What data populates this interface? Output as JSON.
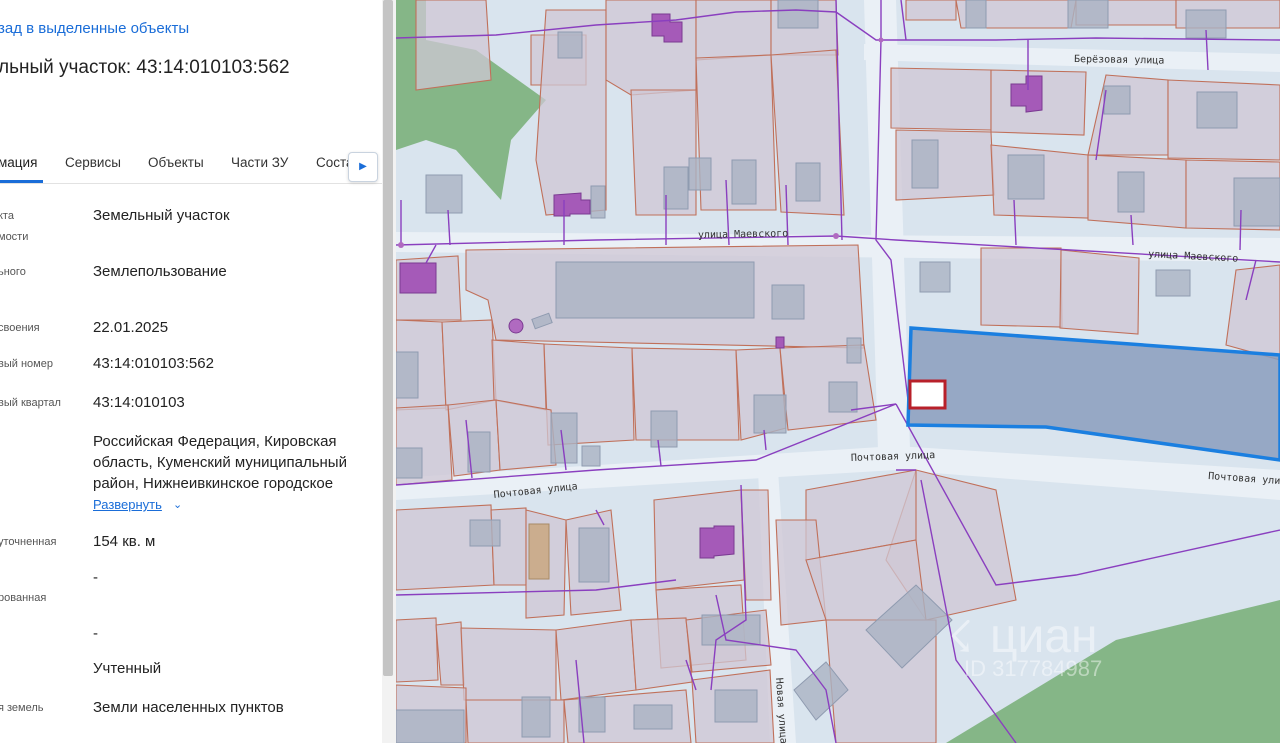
{
  "panel": {
    "back_link": "зад в выделенные объекты",
    "title": "льный участок: 43:14:010103:562",
    "tabs": [
      {
        "label": "мация",
        "active": true
      },
      {
        "label": "Сервисы",
        "active": false
      },
      {
        "label": "Объекты",
        "active": false
      },
      {
        "label": "Части ЗУ",
        "active": false
      },
      {
        "label": "Соста",
        "active": false
      }
    ],
    "tab_scroll_icon": "chevron-right-icon",
    "fields": [
      {
        "label_lines": [
          "кта",
          "мости"
        ],
        "value": "Земельный участок"
      },
      {
        "label_lines": [
          "ьного"
        ],
        "value": "Землепользование"
      },
      {
        "label_lines": [
          "своения"
        ],
        "value": "22.01.2025"
      },
      {
        "label_lines": [
          "вый номер"
        ],
        "value": "43:14:010103:562"
      },
      {
        "label_lines": [
          "вый квартал"
        ],
        "value": "43:14:010103"
      },
      {
        "label_lines": [],
        "value": "Российская Федерация, Кировская область, Куменский муниципальный район, Нижнеивкинское городское"
      },
      {
        "label_lines": [
          "уточненная"
        ],
        "value": "154 кв. м"
      },
      {
        "label_lines": [
          "рованная"
        ],
        "value": "-"
      },
      {
        "label_lines": [],
        "value": "-"
      },
      {
        "label_lines": [],
        "value": "Учтенный"
      },
      {
        "label_lines": [
          "я земель"
        ],
        "value": "Земли населенных пунктов"
      }
    ],
    "expand_label": "Развернуть"
  },
  "map": {
    "streets": {
      "berezovaya": "Берёзовая улица",
      "maevskogo_1": "улица Маевского",
      "maevskogo_2": "улица Маевского",
      "pochtovaya_1": "Почтовая улица",
      "pochtovaya_2": "Почтовая улица",
      "pochtovaya_3": "Почтовая улица",
      "novaya": "Новая улица"
    },
    "watermark": {
      "brand": "циан",
      "id": "ID 317784987"
    },
    "colors": {
      "selected_parcel_stroke": "#1b7fe0",
      "selected_parcel_fill": "#8a9dbd",
      "marker_stroke": "#b8202a",
      "utility_line": "#8a3fbf",
      "parcel_border": "#c0705a",
      "green_area": "#7bb07b"
    }
  }
}
